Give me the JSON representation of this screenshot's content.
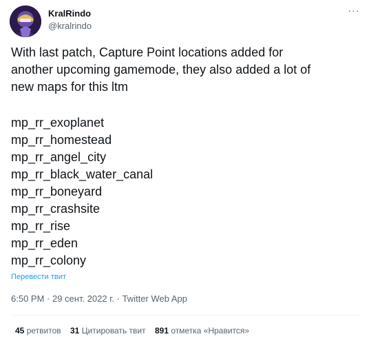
{
  "author": {
    "display_name": "KralRindo",
    "handle": "@kralrindo"
  },
  "more_glyph": "···",
  "tweet": {
    "text_lines": [
      "With last patch, Capture Point locations added for",
      "another upcoming gamemode, they also added a lot of",
      "new maps for this ltm"
    ],
    "maps": [
      "mp_rr_exoplanet",
      "mp_rr_homestead",
      "mp_rr_angel_city",
      "mp_rr_black_water_canal",
      "mp_rr_boneyard",
      "mp_rr_crashsite",
      "mp_rr_rise",
      "mp_rr_eden",
      "mp_rr_colony"
    ]
  },
  "translate_label": "Перевести твит",
  "meta": {
    "time": "6:50 PM",
    "separator": " · ",
    "date": "29 сент. 2022 г.",
    "source": "Twitter Web App"
  },
  "stats": {
    "retweets_count": "45",
    "retweets_label": "ретвитов",
    "quotes_count": "31",
    "quotes_label": "Цитировать твит",
    "likes_count": "891",
    "likes_label": "отметка «Нравится»"
  }
}
